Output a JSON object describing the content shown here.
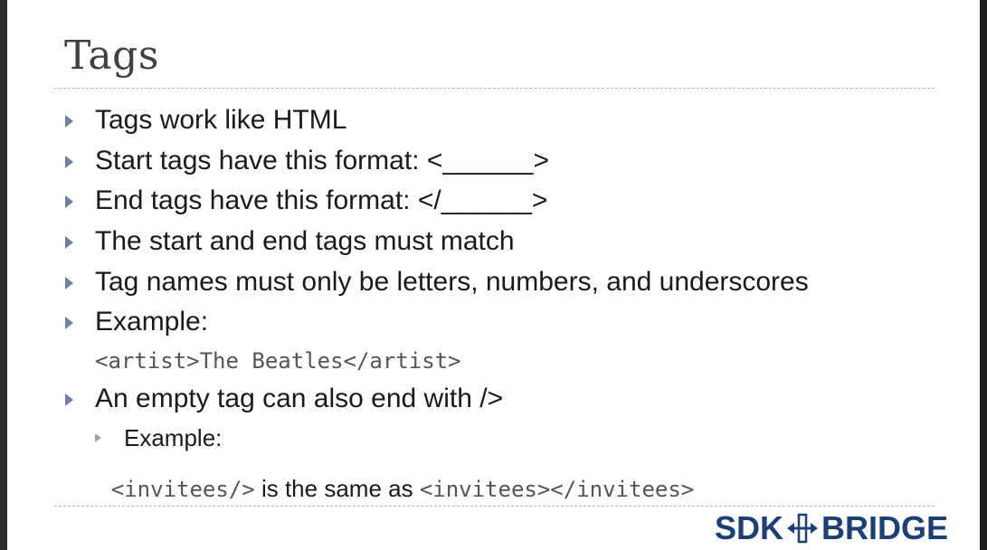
{
  "slide": {
    "title": "Tags",
    "bullets": [
      "Tags work like HTML",
      "Start tags have this format: <______>",
      "End tags have this format: </______>",
      "The start and end tags must match",
      "Tag names must only be letters, numbers, and underscores",
      "Example:"
    ],
    "code_example": "<artist>The Beatles</artist>",
    "empty_tag_bullet": "An empty tag can also end with />",
    "sub_bullet": "Example:",
    "empty_tag_example": {
      "code_a": "<invitees/>",
      "middle": " is the same as ",
      "code_b": "<invitees></invitees>"
    }
  },
  "logo": {
    "left": "SDK",
    "right": "BRIDGE"
  },
  "colors": {
    "bullet": "#6f7fa0",
    "logo": "#1c3f74",
    "title": "#404040"
  }
}
